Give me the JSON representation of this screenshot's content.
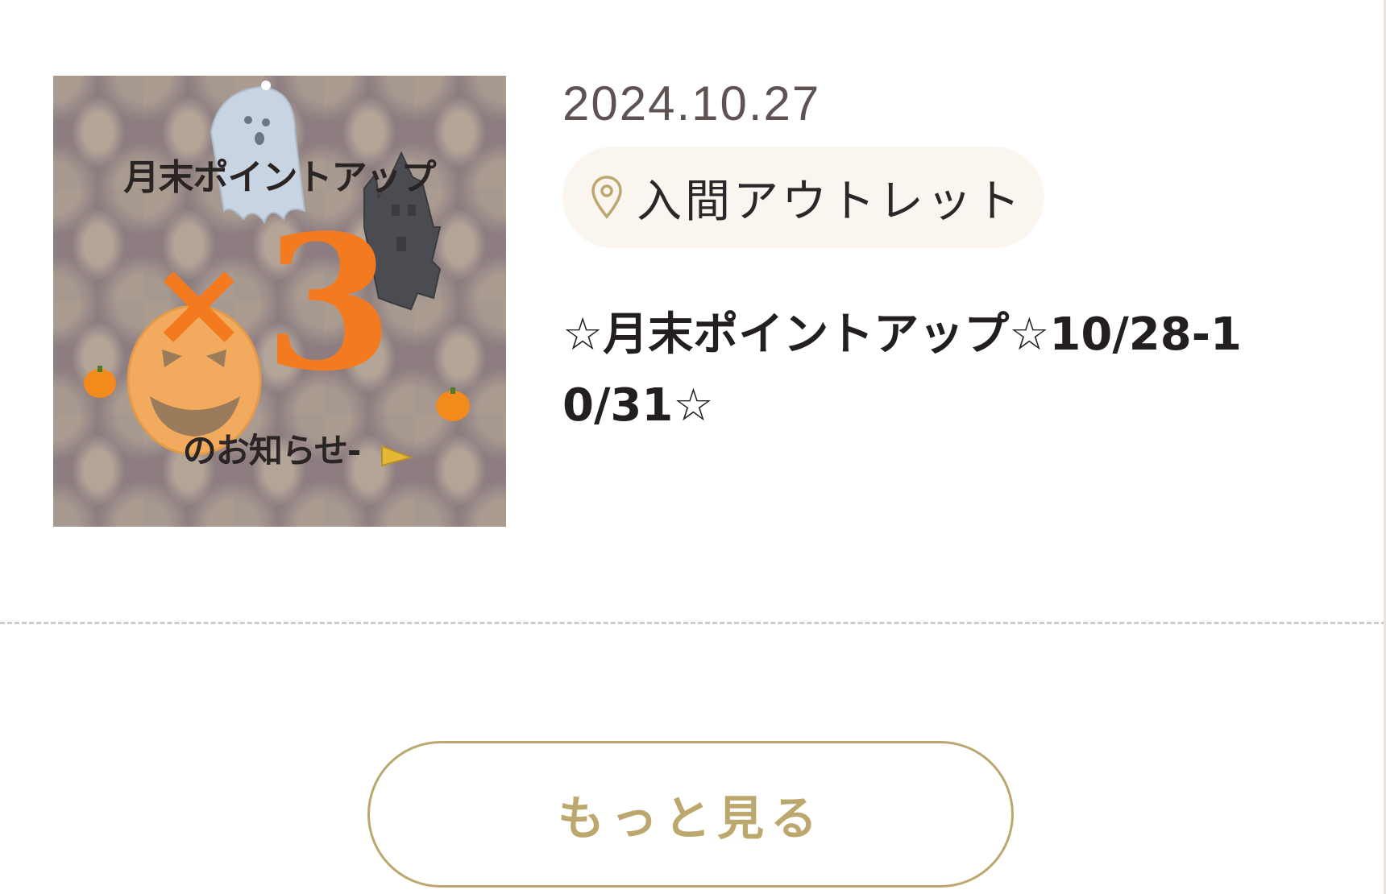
{
  "news_list": {
    "items": [
      {
        "date": "2024.10.27",
        "location": "入間アウトレット",
        "title": "☆月末ポイントアップ☆10/28-10/31☆",
        "thumbnail": {
          "headline": "月末ポイントアップ",
          "multiplier_symbol": "×",
          "multiplier_value": "3",
          "subline": "のお知らせ-",
          "icons": [
            "ghost-icon",
            "haunted-house-icon",
            "jack-o-lantern-icon",
            "pumpkin-icon",
            "megaphone-icon"
          ]
        }
      }
    ]
  },
  "more_button": {
    "label": "もっと見る"
  },
  "colors": {
    "accent_gold": "#bca76e",
    "tag_background": "#faf6ef",
    "date_text": "#5e5352",
    "title_text": "#231f20",
    "divider": "#cfcbc8",
    "thumb_orange": "#f47a20"
  }
}
